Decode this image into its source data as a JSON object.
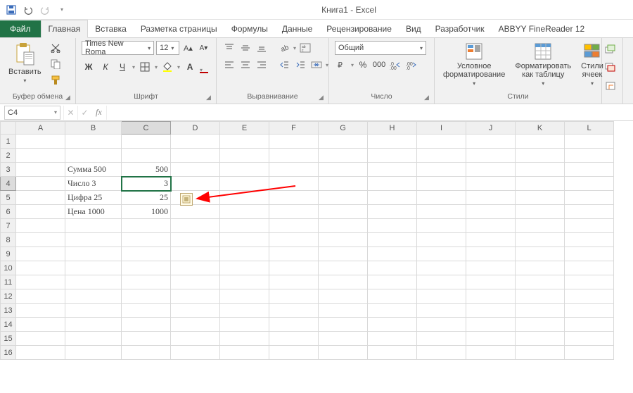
{
  "app": {
    "title": "Книга1 - Excel"
  },
  "tabs": {
    "file": "Файл",
    "list": [
      "Главная",
      "Вставка",
      "Разметка страницы",
      "Формулы",
      "Данные",
      "Рецензирование",
      "Вид",
      "Разработчик",
      "ABBYY FineReader 12"
    ],
    "active": 0
  },
  "ribbon": {
    "clipboard": {
      "label": "Буфер обмена",
      "paste": "Вставить"
    },
    "font": {
      "label": "Шрифт",
      "name": "Times New Roma",
      "size": "12",
      "bold": "Ж",
      "italic": "К",
      "underline": "Ч"
    },
    "align": {
      "label": "Выравнивание"
    },
    "number": {
      "label": "Число",
      "format": "Общий"
    },
    "styles": {
      "label": "Стили",
      "cond": "Условное\nформатирование",
      "table": "Форматировать\nкак таблицу",
      "cell": "Стили\nячеек"
    }
  },
  "fx": {
    "cellref": "C4"
  },
  "columns": [
    "A",
    "B",
    "C",
    "D",
    "E",
    "F",
    "G",
    "H",
    "I",
    "J",
    "K",
    "L"
  ],
  "rows": 16,
  "cells": {
    "B3": "Сумма 500",
    "C3": "500",
    "B4": "Число 3",
    "C4": "3",
    "B5": "Цифра 25",
    "C5": "25",
    "B6": "Цена 1000",
    "C6": "1000"
  },
  "selected": {
    "col": "C",
    "row": 4
  }
}
